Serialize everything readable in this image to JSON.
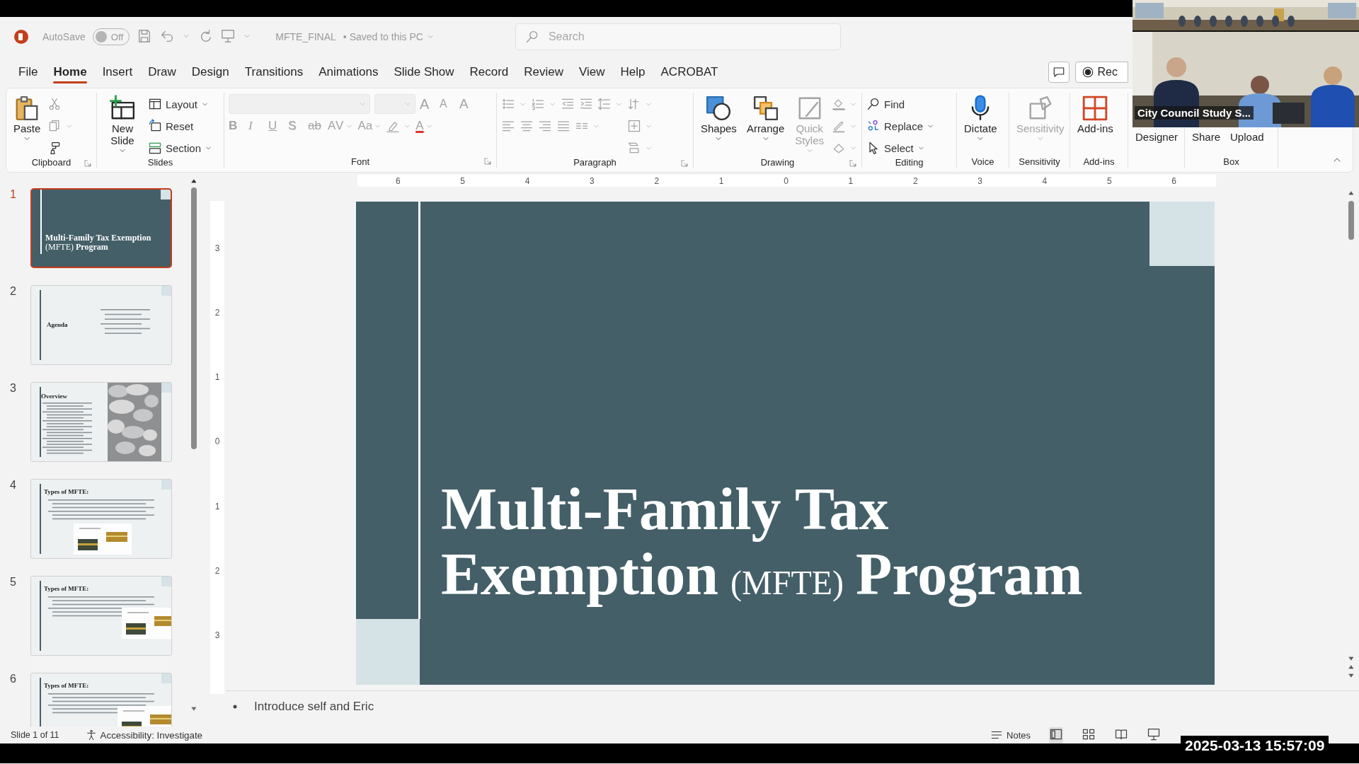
{
  "title_bar": {
    "autosave_label": "AutoSave",
    "autosave": {
      "on": false,
      "label": "Off"
    },
    "file_name": "MFTE_FINAL",
    "save_status": "• Saved to this PC",
    "search": {
      "placeholder": "Search"
    }
  },
  "menu_tabs": [
    {
      "label": "File",
      "selected": false
    },
    {
      "label": "Home",
      "selected": true
    },
    {
      "label": "Insert",
      "selected": false
    },
    {
      "label": "Draw",
      "selected": false
    },
    {
      "label": "Design",
      "selected": false
    },
    {
      "label": "Transitions",
      "selected": false
    },
    {
      "label": "Animations",
      "selected": false
    },
    {
      "label": "Slide Show",
      "selected": false
    },
    {
      "label": "Record",
      "selected": false
    },
    {
      "label": "Review",
      "selected": false
    },
    {
      "label": "View",
      "selected": false
    },
    {
      "label": "Help",
      "selected": false
    },
    {
      "label": "ACROBAT",
      "selected": false
    }
  ],
  "record_button": "Rec",
  "ribbon": {
    "groups": [
      {
        "label": "Clipboard",
        "launcher": true,
        "blocks": [
          {
            "kind": "large",
            "label": "Paste",
            "dropdown": true,
            "disabled": false
          },
          {
            "kind": "grid",
            "rows": [
              [
                {
                  "kind": "button",
                  "dropdown": false,
                  "disabled": true
                }
              ],
              [
                {
                  "kind": "button",
                  "dropdown": true,
                  "disabled": true
                }
              ],
              [
                {
                  "kind": "button",
                  "dropdown": false,
                  "disabled": false
                }
              ]
            ]
          }
        ]
      },
      {
        "label": "Slides",
        "launcher": false,
        "blocks": [
          {
            "kind": "large",
            "label": "New Slide",
            "dropdown": true,
            "disabled": false
          },
          {
            "kind": "grid",
            "rows": [
              [
                {
                  "kind": "button",
                  "label": "Layout",
                  "dropdown": true,
                  "disabled": false
                }
              ],
              [
                {
                  "kind": "button",
                  "label": "Reset",
                  "dropdown": false,
                  "disabled": false
                }
              ],
              [
                {
                  "kind": "button",
                  "label": "Section",
                  "dropdown": true,
                  "disabled": false
                }
              ]
            ]
          }
        ]
      },
      {
        "label": "Font",
        "launcher": true,
        "blocks": [
          {
            "kind": "grid",
            "rows": [
              [
                {
                  "kind": "field",
                  "dropdown": true,
                  "disabled": true
                },
                {
                  "kind": "sizefield",
                  "dropdown": true,
                  "disabled": true
                },
                {
                  "kind": "glyph",
                  "label": "A",
                  "dropdown": false,
                  "disabled": true
                },
                {
                  "kind": "glyph",
                  "label": "A",
                  "dropdown": false,
                  "disabled": true
                },
                {
                  "kind": "glyph",
                  "label": "A",
                  "dropdown": false,
                  "disabled": true
                }
              ],
              [
                {
                  "kind": "glyph",
                  "label": "B",
                  "dropdown": false,
                  "disabled": true
                },
                {
                  "kind": "glyph",
                  "label": "I",
                  "dropdown": false,
                  "disabled": true
                },
                {
                  "kind": "glyph",
                  "label": "U",
                  "dropdown": false,
                  "disabled": true
                },
                {
                  "kind": "glyph",
                  "label": "S",
                  "dropdown": false,
                  "disabled": true
                },
                {
                  "kind": "glyph",
                  "label": "ab",
                  "dropdown": false,
                  "disabled": true
                },
                {
                  "kind": "glyph",
                  "label": "AV",
                  "dropdown": true,
                  "disabled": true
                },
                {
                  "kind": "glyph",
                  "label": "Aa",
                  "dropdown": true,
                  "disabled": true
                },
                {
                  "kind": "button",
                  "dropdown": true,
                  "disabled": true
                },
                {
                  "kind": "glyph",
                  "label": "A",
                  "dropdown": true,
                  "disabled": true
                }
              ]
            ]
          }
        ]
      },
      {
        "label": "Paragraph",
        "launcher": true,
        "blocks": [
          {
            "kind": "grid",
            "rows": [
              [
                {
                  "kind": "button",
                  "dropdown": true,
                  "disabled": true
                },
                {
                  "kind": "button",
                  "dropdown": true,
                  "disabled": true
                },
                {
                  "kind": "button",
                  "dropdown": false,
                  "disabled": true
                },
                {
                  "kind": "button",
                  "dropdown": false,
                  "disabled": true
                },
                {
                  "kind": "button",
                  "dropdown": true,
                  "disabled": true
                }
              ],
              [
                {
                  "kind": "button",
                  "dropdown": false,
                  "disabled": true
                },
                {
                  "kind": "button",
                  "dropdown": false,
                  "disabled": true
                },
                {
                  "kind": "button",
                  "dropdown": false,
                  "disabled": true
                },
                {
                  "kind": "button",
                  "dropdown": false,
                  "disabled": true
                },
                {
                  "kind": "button",
                  "dropdown": true,
                  "disabled": true
                }
              ]
            ]
          },
          {
            "kind": "grid",
            "rows": [
              [
                {
                  "kind": "button",
                  "dropdown": true,
                  "disabled": true
                }
              ],
              [
                {
                  "kind": "button",
                  "dropdown": true,
                  "disabled": true
                }
              ],
              [
                {
                  "kind": "button",
                  "dropdown": true,
                  "disabled": true
                }
              ]
            ]
          }
        ]
      },
      {
        "label": "Drawing",
        "launcher": true,
        "blocks": [
          {
            "kind": "large",
            "label": "Shapes",
            "dropdown": true,
            "disabled": false
          },
          {
            "kind": "large",
            "label": "Arrange",
            "dropdown": true,
            "disabled": false
          },
          {
            "kind": "large",
            "label": "Quick Styles",
            "dropdown": true,
            "disabled": true
          },
          {
            "kind": "grid",
            "rows": [
              [
                {
                  "kind": "button",
                  "dropdown": true,
                  "disabled": true
                }
              ],
              [
                {
                  "kind": "button",
                  "dropdown": true,
                  "disabled": true
                }
              ],
              [
                {
                  "kind": "button",
                  "dropdown": true,
                  "disabled": true
                }
              ]
            ]
          }
        ]
      },
      {
        "label": "Editing",
        "launcher": false,
        "blocks": [
          {
            "kind": "grid",
            "rows": [
              [
                {
                  "kind": "button",
                  "label": "Find",
                  "dropdown": false,
                  "disabled": false
                }
              ],
              [
                {
                  "kind": "button",
                  "label": "Replace",
                  "dropdown": true,
                  "disabled": false
                }
              ],
              [
                {
                  "kind": "button",
                  "label": "Select",
                  "dropdown": true,
                  "disabled": false
                }
              ]
            ]
          }
        ]
      },
      {
        "label": "Voice",
        "launcher": false,
        "blocks": [
          {
            "kind": "large",
            "label": "Dictate",
            "dropdown": true,
            "disabled": false
          }
        ]
      },
      {
        "label": "Sensitivity",
        "launcher": false,
        "blocks": [
          {
            "kind": "large",
            "label": "Sensitivity",
            "dropdown": true,
            "disabled": true
          }
        ]
      },
      {
        "label": "Add-ins",
        "launcher": false,
        "blocks": [
          {
            "kind": "large",
            "label": "Add-ins",
            "dropdown": false,
            "disabled": false
          }
        ]
      },
      {
        "launcher": false,
        "blocks": [
          {
            "kind": "large",
            "label": "Designer",
            "dropdown": false,
            "disabled": false
          }
        ]
      },
      {
        "label": "Box",
        "launcher": false,
        "blocks": [
          {
            "kind": "large",
            "label": "Share",
            "dropdown": false,
            "disabled": false
          },
          {
            "kind": "large",
            "label": "Upload",
            "dropdown": false,
            "disabled": false
          }
        ]
      }
    ]
  },
  "ruler": {
    "horizontal": [
      "6",
      "5",
      "4",
      "3",
      "2",
      "1",
      "0",
      "1",
      "2",
      "3",
      "4",
      "5",
      "6"
    ],
    "vertical": [
      "3",
      "2",
      "1",
      "0",
      "1",
      "2",
      "3"
    ]
  },
  "thumbnails": [
    {
      "number": "1",
      "kind": "title",
      "title": "**Multi-Family Tax Exemption** (MFTE) **Program**",
      "selected": true
    },
    {
      "number": "2",
      "kind": "agenda",
      "title": "Agenda",
      "selected": false
    },
    {
      "number": "3",
      "title": "Overview",
      "selected": false
    },
    {
      "number": "4",
      "kind": "content",
      "title": "Types of MFTE:",
      "selected": false
    },
    {
      "number": "5",
      "kind": "content",
      "title": "Types of MFTE:",
      "selected": false
    },
    {
      "number": "6",
      "kind": "content",
      "title": "Types of MFTE:",
      "selected": false
    }
  ],
  "slide": {
    "title": "**Multi-Family Tax Exemption** (MFTE) **Program**"
  },
  "notes": [
    "Introduce self and Eric"
  ],
  "status_bar": {
    "slide_position": "Slide 1 of 11",
    "accessibility": "Accessibility: Investigate",
    "notes_button": "Notes"
  },
  "video": {
    "label": "City Council Study S...",
    "timestamp": "2025-03-13 15:57:09"
  }
}
